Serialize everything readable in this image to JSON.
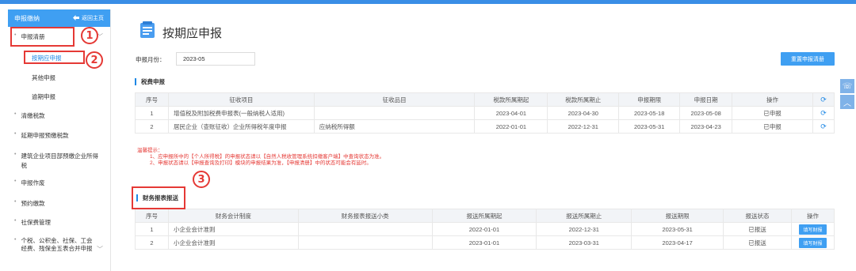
{
  "sidebar": {
    "header": "申报缴纳",
    "back_label": "返回主页",
    "items": [
      {
        "label": "申报清册"
      },
      {
        "label": "清缴税款"
      },
      {
        "label": "延期申报预缴税款"
      },
      {
        "label": "建筑企业项目部预缴企业所得税"
      },
      {
        "label": "申报作废"
      },
      {
        "label": "预约缴款"
      },
      {
        "label": "社保费管理"
      },
      {
        "label": "个税、公积金、社保、工会经费、残保金五表合并申报"
      }
    ],
    "sub_items": [
      {
        "label": "按期应申报"
      },
      {
        "label": "其他申报"
      },
      {
        "label": "逾期申报"
      }
    ]
  },
  "annotations": {
    "one": "1",
    "two": "2",
    "three": "3"
  },
  "page": {
    "title": "按期应申报",
    "month_label": "申报月份：",
    "month_value": "2023-05",
    "reset_button": "重置申报清册"
  },
  "tax_section": {
    "title": "税费申报",
    "headers": [
      "序号",
      "征收项目",
      "征收品目",
      "税款所属期起",
      "税款所属期止",
      "申报期限",
      "申报日期",
      "操作"
    ],
    "rows": [
      [
        "1",
        "增值税及附加税费申报表(一般纳税人适用)",
        "",
        "2023-04-01",
        "2023-04-30",
        "2023-05-18",
        "2023-05-08",
        "已申报"
      ],
      [
        "2",
        "居民企业（查账征收）企业所得税年度申报",
        "应纳税所得额",
        "2022-01-01",
        "2022-12-31",
        "2023-05-31",
        "2023-04-23",
        "已申报"
      ]
    ]
  },
  "notice": {
    "title": "温馨提示：",
    "line1": "1、应申报所中的【个人所得税】的申报状态请以【自然人税收管理系统扣缴客户端】中查询状态为准。",
    "line2": "2、申报状态请以【申报查询及打印】模块的申报结果为准，【申报清册】中的状态可能会有延时。"
  },
  "finance_section": {
    "title": "财务报表报送",
    "headers": [
      "序号",
      "财务会计制度",
      "财务报表报送小类",
      "报送所属期起",
      "报送所属期止",
      "报送期限",
      "报送状态",
      "操作"
    ],
    "rows": [
      [
        "1",
        "小企业会计准则",
        "",
        "2022-01-01",
        "2022-12-31",
        "2023-05-31",
        "已报送",
        "填写财报"
      ],
      [
        "2",
        "小企业会计准则",
        "",
        "2023-01-01",
        "2023-03-31",
        "2023-04-17",
        "已报送",
        "填写财报"
      ]
    ]
  },
  "colors": {
    "accent": "#3f9ff2",
    "highlight": "#e53935"
  }
}
